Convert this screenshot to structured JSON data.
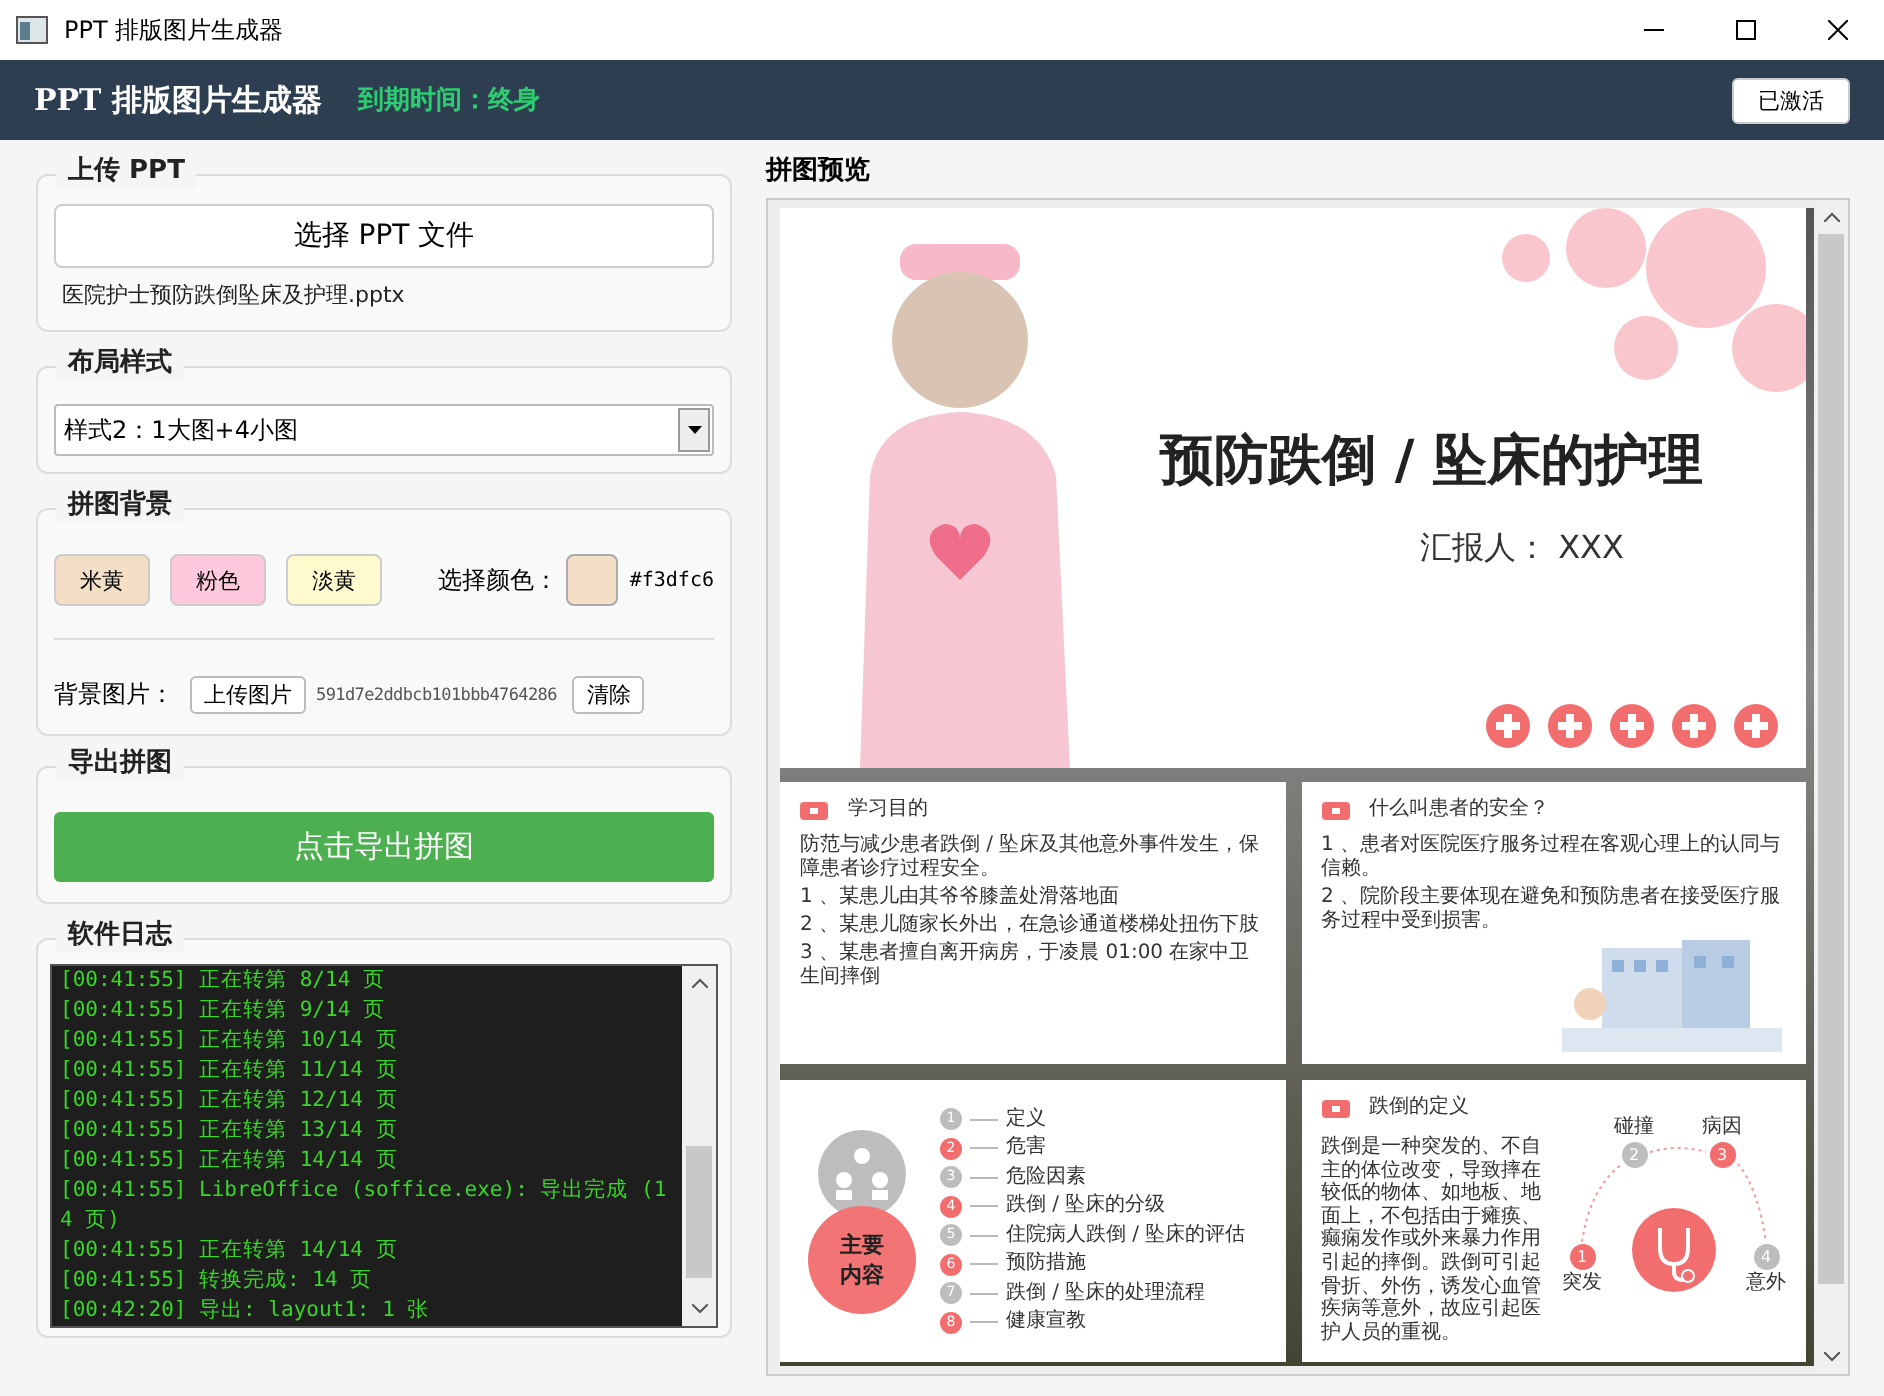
{
  "window": {
    "title": "PPT 排版图片生成器"
  },
  "header": {
    "app_name": "PPT 排版图片生成器",
    "expiry": "到期时间：终身",
    "activation_button": "已激活"
  },
  "upload": {
    "title": "上传 PPT",
    "choose_button": "选择 PPT 文件",
    "file_name": "医院护士预防跌倒坠床及护理.pptx"
  },
  "layout": {
    "title": "布局样式",
    "style_value": "样式2：1大图+4小图"
  },
  "background": {
    "title": "拼图背景",
    "presets": [
      {
        "label": "米黄",
        "color": "#f3dfc6"
      },
      {
        "label": "粉色",
        "color": "#ffc8dc"
      },
      {
        "label": "淡黄",
        "color": "#fffacd"
      }
    ],
    "pick_label": "选择颜色：",
    "picked_color": "#f3dfc6",
    "image_label": "背景图片：",
    "upload_image_button": "上传图片",
    "image_name": "591d7e2ddbcb101bbb4764286",
    "clear_button": "清除"
  },
  "export": {
    "title": "导出拼图",
    "export_button": "点击导出拼图"
  },
  "log": {
    "title": "软件日志",
    "lines": [
      "[00:41:55] 正在转第 8/14 页",
      "[00:41:55] 正在转第 9/14 页",
      "[00:41:55] 正在转第 10/14 页",
      "[00:41:55] 正在转第 11/14 页",
      "[00:41:55] 正在转第 12/14 页",
      "[00:41:55] 正在转第 13/14 页",
      "[00:41:55] 正在转第 14/14 页",
      "[00:41:55] LibreOffice (soffice.exe): 导出完成 (14 页)",
      "[00:41:55] 正在转第 14/14 页",
      "[00:41:55] 转换完成: 14 页",
      "[00:42:20] 导出: layout1: 1 张"
    ]
  },
  "preview": {
    "title": "拼图预览",
    "cover": {
      "title": "预防跌倒 / 坠床的护理",
      "reporter": "汇报人：  XXX"
    },
    "slide_goal": {
      "heading": "学习目的",
      "intro": "防范与减少患者跌倒 / 坠床及其他意外事件发生，保障患者诊疗过程安全。",
      "items": [
        "1 、某患儿由其爷爷膝盖处滑落地面",
        "2 、某患儿随家长外出，在急诊通道楼梯处扭伤下肢",
        "3 、某患者擅自离开病房，于凌晨 01:00 在家中卫生间摔倒"
      ]
    },
    "slide_safety": {
      "heading": "什么叫患者的安全？",
      "items": [
        "1 、患者对医院医疗服务过程在客观心理上的认同与信赖。",
        "2 、院阶段主要体现在避免和预防患者在接受医疗服务过程中受到损害。"
      ]
    },
    "slide_contents": {
      "heading": "主要内容",
      "items": [
        {
          "number": "1",
          "label": "定义",
          "color": "#bdbdbd"
        },
        {
          "number": "2",
          "label": "危害",
          "color": "#f26d6d"
        },
        {
          "number": "3",
          "label": "危险因素",
          "color": "#bdbdbd"
        },
        {
          "number": "4",
          "label": "跌倒 / 坠床的分级",
          "color": "#f26d6d"
        },
        {
          "number": "5",
          "label": "住院病人跌倒 / 坠床的评估",
          "color": "#bdbdbd"
        },
        {
          "number": "6",
          "label": "预防措施",
          "color": "#f26d6d"
        },
        {
          "number": "7",
          "label": "跌倒 / 坠床的处理流程",
          "color": "#bdbdbd"
        },
        {
          "number": "8",
          "label": "健康宣教",
          "color": "#f26d6d"
        }
      ]
    },
    "slide_definition": {
      "heading": "跌倒的定义",
      "paragraph": "跌倒是一种突发的、不自主的体位改变，导致摔在较低的物体、如地板、地面上，不包括由于瘫痪、癫痫发作或外来暴力作用引起的摔倒。跌倒可引起骨折、外伤，诱发心血管疾病等意外，故应引起医护人员的重视。",
      "nodes": [
        {
          "number": "1",
          "label": "突发",
          "color": "#f26d6d"
        },
        {
          "number": "2",
          "label": "碰撞",
          "color": "#bdbdbd"
        },
        {
          "number": "3",
          "label": "病因",
          "color": "#f26d6d"
        },
        {
          "number": "4",
          "label": "意外",
          "color": "#bdbdbd"
        }
      ]
    }
  }
}
